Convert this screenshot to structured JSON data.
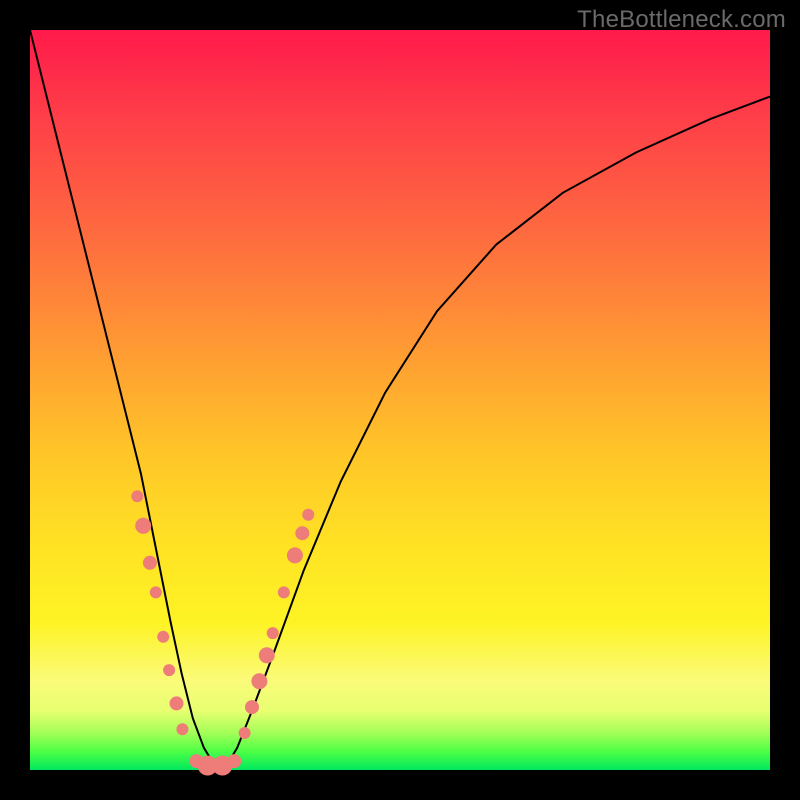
{
  "watermark": "TheBottleneck.com",
  "colors": {
    "frame": "#000000",
    "gradient_top": "#ff1a4b",
    "gradient_bottom": "#00e85e",
    "curve": "#000000",
    "marker": "#ee7c78"
  },
  "chart_data": {
    "type": "line",
    "title": "",
    "xlabel": "",
    "ylabel": "",
    "xlim": [
      0,
      100
    ],
    "ylim": [
      0,
      100
    ],
    "series": [
      {
        "name": "bottleneck-curve",
        "x": [
          0,
          3,
          6,
          9,
          12,
          15,
          17,
          19,
          20.5,
          22,
          23.5,
          25,
          26.5,
          28,
          30,
          33,
          37,
          42,
          48,
          55,
          63,
          72,
          82,
          92,
          100
        ],
        "values": [
          100,
          88,
          76,
          64,
          52,
          40,
          30,
          20,
          13,
          7,
          3,
          0.5,
          0.5,
          3,
          8,
          16,
          27,
          39,
          51,
          62,
          71,
          78,
          83.5,
          88,
          91
        ]
      }
    ],
    "markers": [
      {
        "x": 14.5,
        "y": 37,
        "r": 6
      },
      {
        "x": 15.3,
        "y": 33,
        "r": 8
      },
      {
        "x": 16.2,
        "y": 28,
        "r": 7
      },
      {
        "x": 17.0,
        "y": 24,
        "r": 6
      },
      {
        "x": 18.0,
        "y": 18,
        "r": 6
      },
      {
        "x": 18.8,
        "y": 13.5,
        "r": 6
      },
      {
        "x": 19.8,
        "y": 9,
        "r": 7
      },
      {
        "x": 20.6,
        "y": 5.5,
        "r": 6
      },
      {
        "x": 22.5,
        "y": 1.2,
        "r": 7
      },
      {
        "x": 24.0,
        "y": 0.6,
        "r": 10
      },
      {
        "x": 26.0,
        "y": 0.6,
        "r": 10
      },
      {
        "x": 27.6,
        "y": 1.2,
        "r": 7
      },
      {
        "x": 29.0,
        "y": 5,
        "r": 6
      },
      {
        "x": 30.0,
        "y": 8.5,
        "r": 7
      },
      {
        "x": 31.0,
        "y": 12,
        "r": 8
      },
      {
        "x": 32.0,
        "y": 15.5,
        "r": 8
      },
      {
        "x": 32.8,
        "y": 18.5,
        "r": 6
      },
      {
        "x": 34.3,
        "y": 24,
        "r": 6
      },
      {
        "x": 35.8,
        "y": 29,
        "r": 8
      },
      {
        "x": 36.8,
        "y": 32,
        "r": 7
      },
      {
        "x": 37.6,
        "y": 34.5,
        "r": 6
      }
    ]
  }
}
